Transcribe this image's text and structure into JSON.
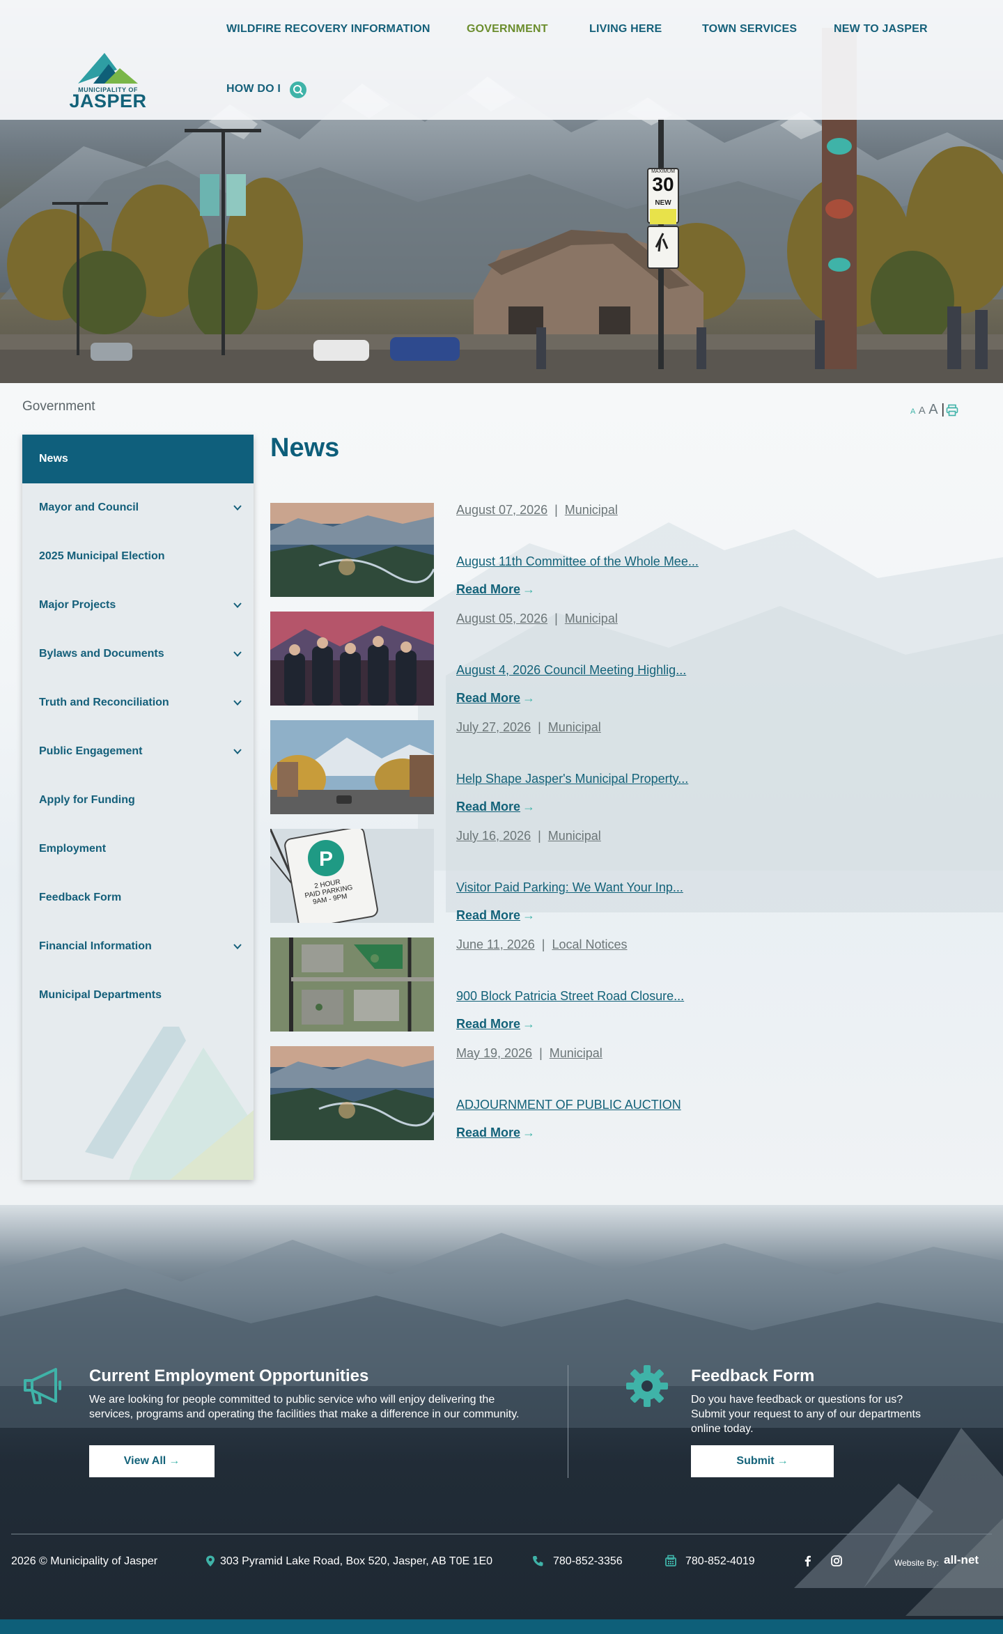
{
  "header": {
    "logo_small": "MUNICIPALITY OF",
    "logo_big": "JASPER",
    "nav": [
      {
        "label": "WILDFIRE RECOVERY INFORMATION",
        "active": false
      },
      {
        "label": "GOVERNMENT",
        "active": true
      },
      {
        "label": "LIVING HERE",
        "active": false
      },
      {
        "label": "TOWN SERVICES",
        "active": false
      },
      {
        "label": "NEW TO JASPER",
        "active": false
      },
      {
        "label": "HOW DO I",
        "active": false
      }
    ],
    "search_icon": "search-icon"
  },
  "hero": {
    "sign_top": "MAXIMUM",
    "sign_speed": "30",
    "sign_new": "NEW"
  },
  "breadcrumb": "Government",
  "text_size": {
    "small": "A",
    "medium": "A",
    "large": "A",
    "separator": "|",
    "print_icon": "print-icon"
  },
  "sidebar": {
    "items": [
      {
        "label": "News",
        "expandable": false,
        "active": true
      },
      {
        "label": "Mayor and Council",
        "expandable": true,
        "active": false
      },
      {
        "label": "2025 Municipal Election",
        "expandable": false,
        "active": false
      },
      {
        "label": "Major Projects",
        "expandable": true,
        "active": false
      },
      {
        "label": "Bylaws and Documents",
        "expandable": true,
        "active": false
      },
      {
        "label": "Truth and Reconciliation",
        "expandable": true,
        "active": false
      },
      {
        "label": "Public Engagement",
        "expandable": true,
        "active": false
      },
      {
        "label": "Apply for Funding",
        "expandable": false,
        "active": false
      },
      {
        "label": "Employment",
        "expandable": false,
        "active": false
      },
      {
        "label": "Feedback Form",
        "expandable": false,
        "active": false
      },
      {
        "label": "Financial Information",
        "expandable": true,
        "active": false
      },
      {
        "label": "Municipal Departments",
        "expandable": false,
        "active": false
      }
    ]
  },
  "news": {
    "title": "News",
    "separator": "|",
    "read_more": "Read More",
    "items": [
      {
        "date": "August 07, 2026",
        "category": "Municipal",
        "headline": "August 11th Committee of the Whole Mee..."
      },
      {
        "date": "August 05, 2026",
        "category": "Municipal",
        "headline": "August 4, 2026 Council Meeting Highlig..."
      },
      {
        "date": "July 27, 2026",
        "category": "Municipal",
        "headline": "Help Shape Jasper's Municipal Property..."
      },
      {
        "date": "July 16, 2026",
        "category": "Municipal",
        "headline": "Visitor Paid Parking: We Want Your Inp..."
      },
      {
        "date": "June 11, 2026",
        "category": "Local Notices",
        "headline": "900 Block Patricia Street Road Closure..."
      },
      {
        "date": "May 19, 2026",
        "category": "Municipal",
        "headline": "ADJOURNMENT OF PUBLIC AUCTION"
      }
    ],
    "parking_sign": {
      "line1": "2 HOUR",
      "line2": "PAID PARKING",
      "line3": "9AM - 9PM"
    }
  },
  "footer": {
    "employment": {
      "icon": "megaphone-icon",
      "title": "Current Employment Opportunities",
      "text": "We are looking for people committed to public service who will enjoy delivering the services, programs and operating the facilities that make a difference in our community.",
      "button": "View All"
    },
    "feedback": {
      "icon": "gear-icon",
      "title": "Feedback Form",
      "text": "Do you have feedback or questions for us? Submit your request to any of our departments online today.",
      "button": "Submit"
    },
    "copyright": "2026 © Municipality of Jasper",
    "address": "303 Pyramid Lake Road, Box 520, Jasper, AB T0E 1E0",
    "phone": "780-852-3356",
    "fax": "780-852-4019",
    "social": [
      "facebook-icon",
      "instagram-icon"
    ],
    "credit_label": "Website By:",
    "credit_name": "all-net"
  },
  "colors": {
    "brand": "#136279",
    "accent": "#3fb3a8",
    "active_nav": "#6b8d2d",
    "sidebar_active": "#0f5f7c",
    "footer_bg": "#212c37"
  }
}
